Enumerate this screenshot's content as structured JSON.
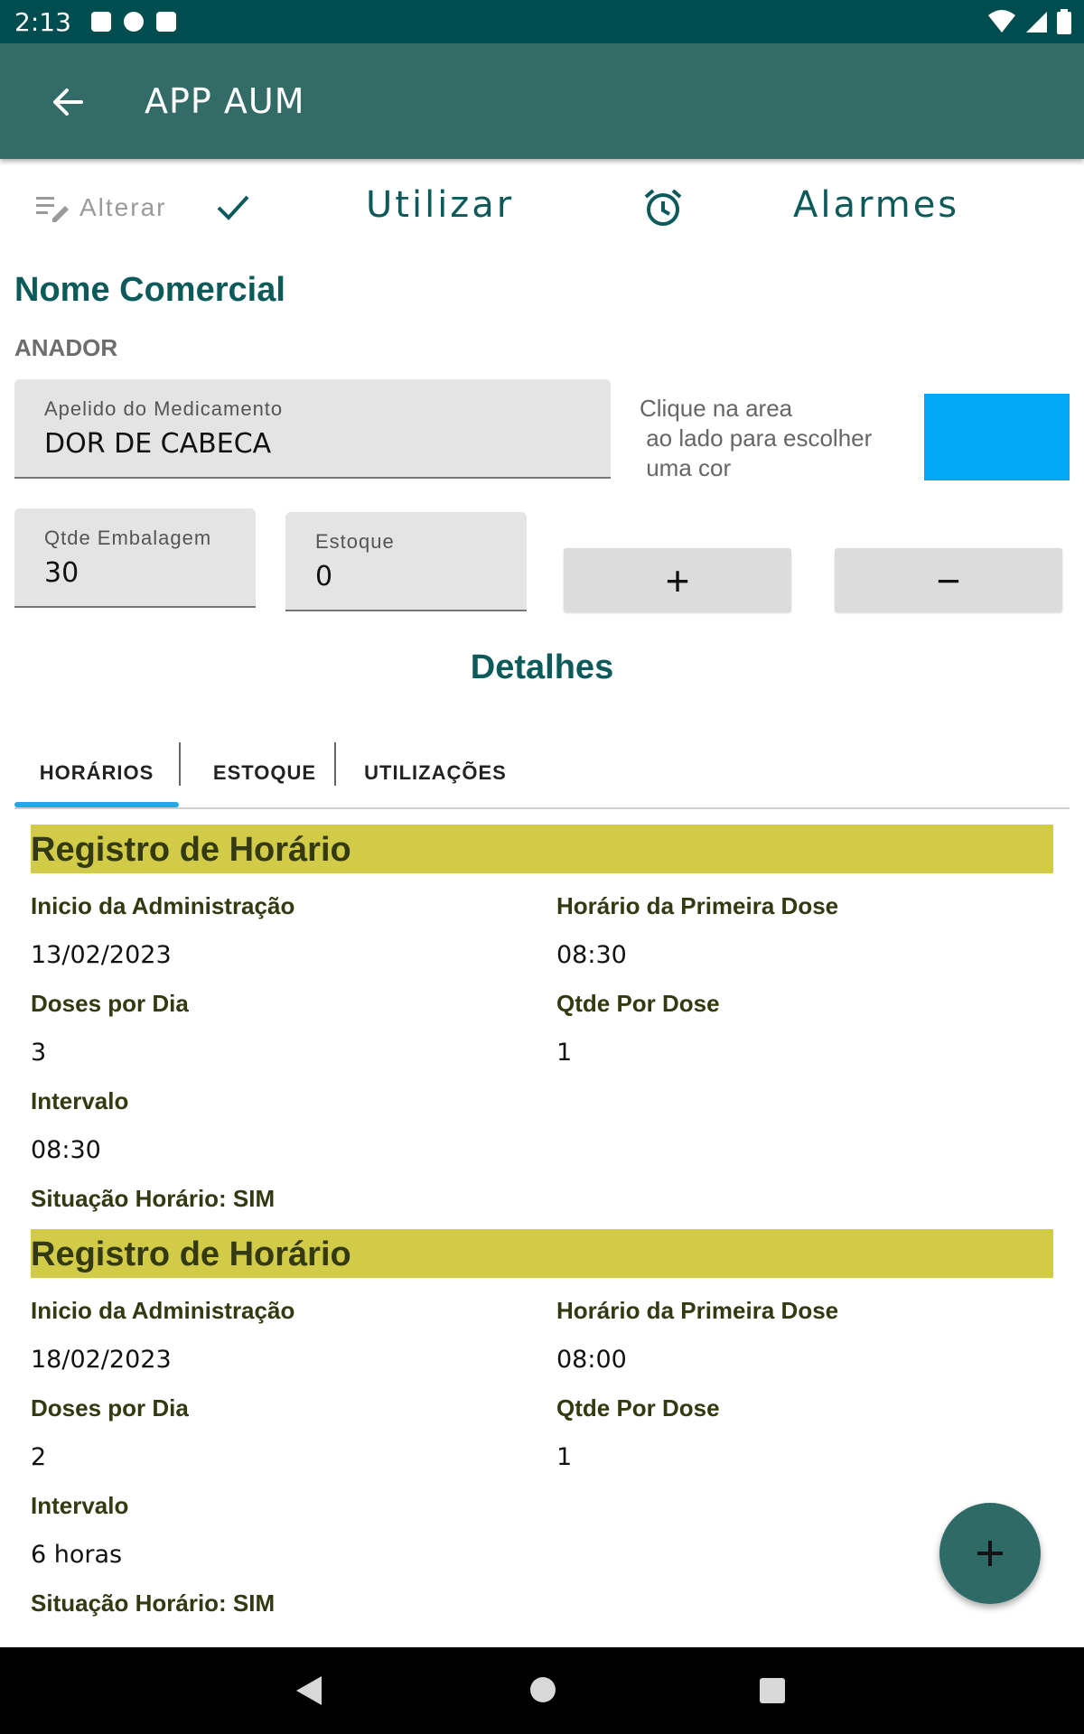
{
  "status_bar": {
    "time": "2:13"
  },
  "app_bar": {
    "title": "APP AUM"
  },
  "actions": {
    "edit_label": "Alterar",
    "use_label": "Utilizar",
    "alarms_label": "Alarmes"
  },
  "product": {
    "section_title": "Nome Comercial",
    "commercial_name": "ANADOR",
    "nickname_label": "Apelido do Medicamento",
    "nickname_value": "DOR DE CABECA",
    "color_hint": "Clique na area\n ao lado para escolher\n uma cor",
    "color": "#03a9f4",
    "package_qty_label": "Qtde Embalagem",
    "package_qty_value": "30",
    "stock_label": "Estoque",
    "stock_value": "0",
    "plus": "+",
    "minus": "−"
  },
  "details": {
    "title": "Detalhes",
    "tabs": [
      {
        "label": "HORÁRIOS",
        "selected": true
      },
      {
        "label": "ESTOQUE",
        "selected": false
      },
      {
        "label": "UTILIZAÇÕES",
        "selected": false
      }
    ]
  },
  "records": [
    {
      "header": "Registro de Horário",
      "start_label": "Inicio da Administração",
      "start_value": "13/02/2023",
      "first_dose_label": "Horário da Primeira Dose",
      "first_dose_value": "08:30",
      "doses_label": "Doses por Dia",
      "doses_value": "3",
      "qty_label": "Qtde Por Dose",
      "qty_value": "1",
      "interval_label": "Intervalo",
      "interval_value": "08:30",
      "status": "Situação Horário: SIM"
    },
    {
      "header": "Registro de Horário",
      "start_label": "Inicio da Administração",
      "start_value": "18/02/2023",
      "first_dose_label": "Horário da Primeira Dose",
      "first_dose_value": "08:00",
      "doses_label": "Doses por Dia",
      "doses_value": "2",
      "qty_label": "Qtde Por Dose",
      "qty_value": "1",
      "interval_label": "Intervalo",
      "interval_value": "6 horas",
      "status": "Situação Horário: SIM"
    }
  ],
  "colors": {
    "primary": "#336b66",
    "status_bar": "#004d4f",
    "accent_text": "#0d5a5a",
    "record_header": "#d1cb48",
    "tab_indicator": "#2aa7e0"
  }
}
